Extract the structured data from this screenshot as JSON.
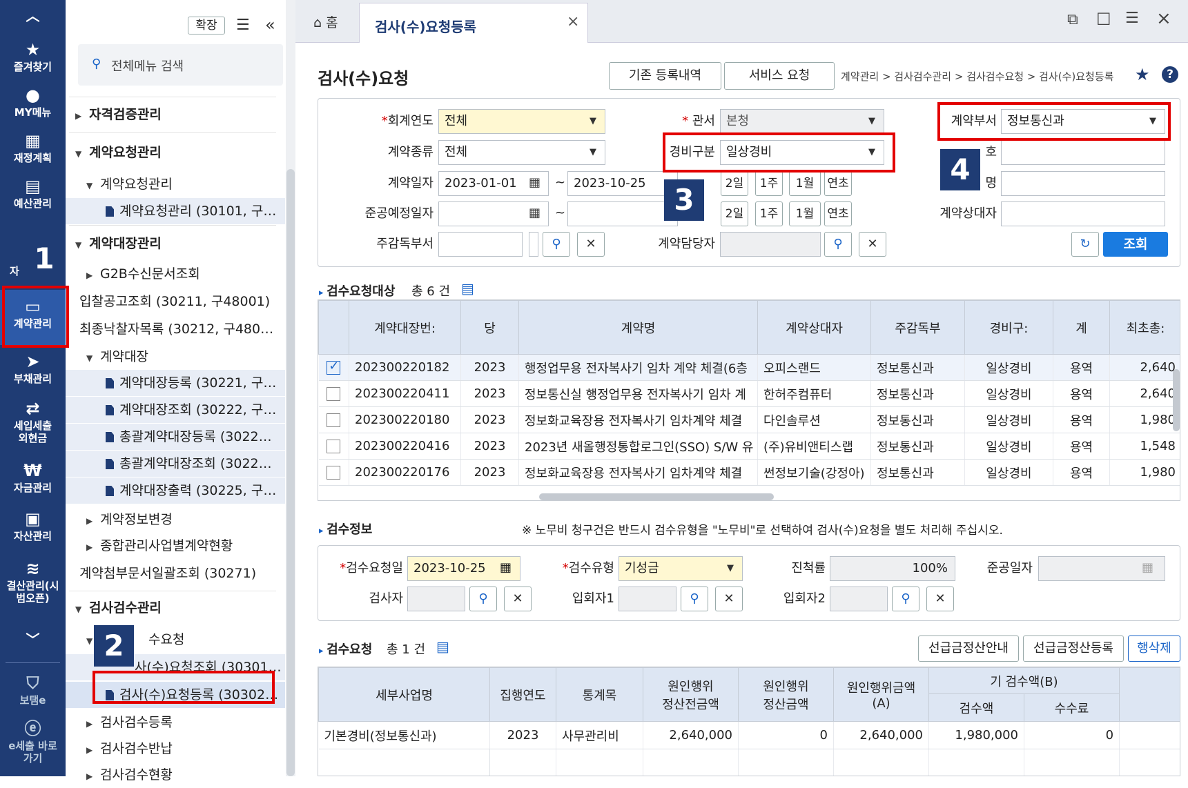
{
  "rail": {
    "items": [
      {
        "label": "즐겨찾기",
        "icon": "star-icon"
      },
      {
        "label": "MY메뉴",
        "icon": "user-icon"
      },
      {
        "label": "재정계획",
        "icon": "calendar-icon"
      },
      {
        "label": "예산관리",
        "icon": "document-icon"
      },
      {
        "label": "자",
        "icon": "money-icon"
      },
      {
        "label": "계약관리",
        "icon": "card-icon"
      },
      {
        "label": "부채관리",
        "icon": "arrow-icon"
      },
      {
        "label": "세입세출외현금",
        "icon": "exchange-icon"
      },
      {
        "label": "자금관리",
        "icon": "won-icon"
      },
      {
        "label": "자산관리",
        "icon": "briefcase-icon"
      },
      {
        "label": "결산관리(시범오픈)",
        "icon": "layers-icon"
      },
      {
        "label": "보탬e",
        "icon": "shield-icon"
      },
      {
        "label": "e세출 바로가기",
        "icon": "e-icon"
      }
    ]
  },
  "sidebar": {
    "expand_label": "확장",
    "search_placeholder": "전체메뉴 검색",
    "tree": [
      {
        "label": "자격검증관리"
      },
      {
        "label": "계약요청관리"
      },
      {
        "label": "계약요청관리"
      },
      {
        "label": "계약요청관리 (30101, 구…"
      },
      {
        "label": "계약대장관리"
      },
      {
        "label": "G2B수신문서조회"
      },
      {
        "label": "입찰공고조회 (30211, 구48001)"
      },
      {
        "label": "최종낙찰자목록 (30212, 구480…"
      },
      {
        "label": "계약대장"
      },
      {
        "label": "계약대장등록 (30221, 구…"
      },
      {
        "label": "계약대장조회 (30222, 구…"
      },
      {
        "label": "총괄계약대장등록 (3022…"
      },
      {
        "label": "총괄계약대장조회 (3022…"
      },
      {
        "label": "계약대장출력 (30225, 구…"
      },
      {
        "label": "계약정보변경"
      },
      {
        "label": "종합관리사업별계약현황"
      },
      {
        "label": "계약첨부문서일괄조회 (30271)"
      },
      {
        "label": "검사검수관리"
      },
      {
        "label": "수요청"
      },
      {
        "label": "사(수)요청조회 (30301…"
      },
      {
        "label": "검사(수)요청등록 (30302…"
      },
      {
        "label": "검사검수등록"
      },
      {
        "label": "검사검수반납"
      },
      {
        "label": "검사검수현황"
      }
    ]
  },
  "tabs": {
    "home": "홈",
    "active": "검사(수)요청등록"
  },
  "page": {
    "title": "검사(수)요청",
    "btn_history": "기존 등록내역",
    "btn_service": "서비스 요청",
    "breadcrumb": "계약관리 > 검사검수관리 > 검사검수요청 > 검사(수)요청등록"
  },
  "search": {
    "fiscal_year_label": "회계연도",
    "fiscal_year": "전체",
    "office_label": "관서",
    "office": "본청",
    "dept_label": "계약부서",
    "dept": "정보통신과",
    "contract_type_label": "계약종류",
    "contract_type": "전체",
    "expense_label": "경비구분",
    "expense": "일상경비",
    "contract_date_label": "계약일자",
    "date_from": "2023-01-01",
    "date_to": "2023-10-25",
    "completion_label": "준공예정일자",
    "supervisor_label": "주감독부서",
    "manager_label": "계약담당자",
    "partner_label": "계약상대자",
    "no_label_partial": "호",
    "name_label_partial": "명",
    "quick": [
      "2일",
      "1주",
      "1월",
      "연초"
    ],
    "tilde": "~",
    "search_btn": "조회"
  },
  "targets": {
    "title": "검수요청대상",
    "count_text": "총 6 건",
    "headers": [
      "계약대장번:",
      "당",
      "계약명",
      "계약상대자",
      "주감독부",
      "경비구:",
      "계",
      "최초총:"
    ],
    "rows": [
      {
        "checked": true,
        "no": "202300220182",
        "year": "2023",
        "name": "행정업무용 전자복사기 임차 계약 체결(6층",
        "partner": "오피스랜드",
        "dept": "정보통신과",
        "exp": "일상경비",
        "type": "용역",
        "amt": "2,640"
      },
      {
        "checked": false,
        "no": "202300220411",
        "year": "2023",
        "name": "정보통신실 행정업무용 전자복사기 임차 계",
        "partner": "한허주컴퓨터",
        "dept": "정보통신과",
        "exp": "일상경비",
        "type": "용역",
        "amt": "2,640"
      },
      {
        "checked": false,
        "no": "202300220180",
        "year": "2023",
        "name": "정보화교육장용 전자복사기 임차계약 체결",
        "partner": "다인솔루션",
        "dept": "정보통신과",
        "exp": "일상경비",
        "type": "용역",
        "amt": "1,980"
      },
      {
        "checked": false,
        "no": "202300220416",
        "year": "2023",
        "name": "2023년 새올행정통합로그인(SSO) S/W 유",
        "partner": "(주)유비앤티스랩",
        "dept": "정보통신과",
        "exp": "일상경비",
        "type": "용역",
        "amt": "1,548"
      },
      {
        "checked": false,
        "no": "202300220176",
        "year": "2023",
        "name": "정보화교육장용 전자복사기 임차계약 체결",
        "partner": "썬정보기술(강정아)",
        "dept": "정보통신과",
        "exp": "일상경비",
        "type": "용역",
        "amt": "1,980"
      }
    ]
  },
  "inspect_info": {
    "title": "검수정보",
    "notice": "※ 노무비 청구건은 반드시 검수유형을 \"노무비\"로 선택하여 검사(수)요청을 별도 처리해 주십시오.",
    "req_date_label": "검수요청일",
    "req_date": "2023-10-25",
    "type_label": "검수유형",
    "type": "기성금",
    "progress_label": "진척률",
    "progress": "100%",
    "done_label": "준공일자",
    "inspector_label": "검사자",
    "witness1_label": "입회자1",
    "witness2_label": "입회자2"
  },
  "requests": {
    "title": "검수요청",
    "count_text": "총 1 건",
    "btn_advance_info": "선급금정산안내",
    "btn_advance_reg": "선급금정산등록",
    "btn_delete": "행삭제",
    "headers": {
      "biz": "세부사업명",
      "year": "집행연도",
      "item": "통계목",
      "pre1": "원인행위",
      "pre2": "정산전금액",
      "post1": "원인행위",
      "post2": "정산금액",
      "amt1": "원인행위금액",
      "amt2": "(A)",
      "prev": "기 검수액(B)",
      "prev_amt": "검수액",
      "prev_fee": "수수료"
    },
    "rows": [
      {
        "biz": "기본경비(정보통신과)",
        "year": "2023",
        "item": "사무관리비",
        "pre": "2,640,000",
        "post": "0",
        "amt": "2,640,000",
        "prev_amt": "1,980,000",
        "prev_fee": "0"
      }
    ]
  },
  "badges": [
    "1",
    "2",
    "3",
    "4"
  ]
}
